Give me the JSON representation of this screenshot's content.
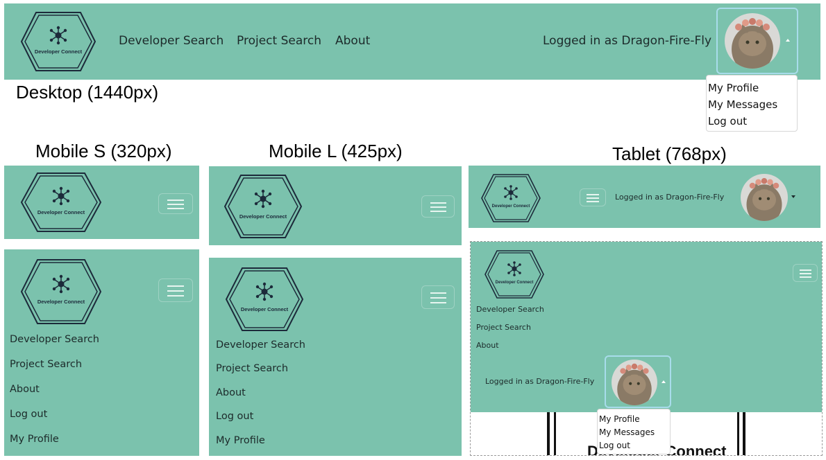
{
  "brand": {
    "name": "Developer Connect"
  },
  "nav": {
    "developer_search": "Developer Search",
    "project_search": "Project Search",
    "about": "About",
    "log_out": "Log out",
    "my_profile": "My Profile"
  },
  "user": {
    "logged_in_text": "Logged in as Dragon-Fire-Fly"
  },
  "dropdown": {
    "items": [
      "My Profile",
      "My Messages",
      "Log out"
    ]
  },
  "captions": {
    "desktop": "Desktop (1440px)",
    "mobile_s": "Mobile S (320px)",
    "mobile_l": "Mobile L (425px)",
    "tablet": "Tablet (768px)"
  },
  "colors": {
    "navbar_bg": "#7bc2ad",
    "page_bg": "#ffffff",
    "avatar_border": "#a8dceb"
  },
  "icons": [
    "network-logo-icon",
    "hamburger-icon",
    "caret-icon",
    "avatar-cat-photo"
  ]
}
